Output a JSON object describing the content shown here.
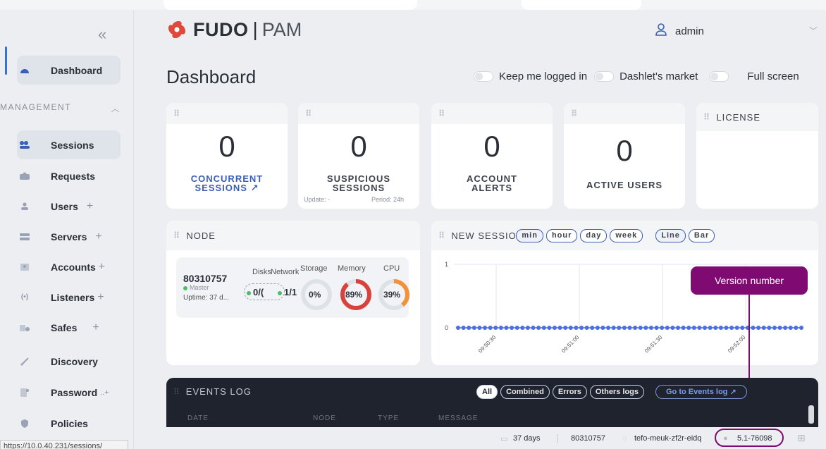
{
  "colors": {
    "accent": "#3a5fb8",
    "brand_red": "#e0483b",
    "annotation": "#7e0a72",
    "memory": "#d9423a",
    "cpu": "#f2913a",
    "series": "#4a6fdf"
  },
  "sidebar": {
    "collapse_icon": "double-chevron-left-icon",
    "section_label": "MANAGEMENT",
    "items": [
      {
        "label": "Dashboard",
        "icon": "dashboard-icon"
      },
      {
        "label": "Sessions",
        "icon": "sessions-icon"
      },
      {
        "label": "Requests",
        "icon": "requests-icon"
      },
      {
        "label": "Users",
        "icon": "users-icon",
        "plus": "+"
      },
      {
        "label": "Servers",
        "icon": "servers-icon",
        "plus": "+"
      },
      {
        "label": "Accounts",
        "icon": "accounts-icon",
        "plus": "+"
      },
      {
        "label": "Listeners",
        "icon": "listeners-icon",
        "plus": "+"
      },
      {
        "label": "Safes",
        "icon": "safes-icon",
        "plus": "+"
      },
      {
        "label": "Discovery",
        "icon": "discovery-icon"
      },
      {
        "label": "Password",
        "icon": "password-icon",
        "plus": "..+"
      },
      {
        "label": "Policies",
        "icon": "policies-icon"
      }
    ],
    "status_url": "https://10.0.40.231/sessions/"
  },
  "header": {
    "brand": "FUDO",
    "separator": "|",
    "product": "PAM",
    "user": "admin",
    "page_title": "Dashboard",
    "toggles": [
      "Keep me logged in",
      "Dashlet's market",
      "Full screen"
    ]
  },
  "stats": {
    "concurrent": {
      "value": "0",
      "label_line1": "CONCURRENT",
      "label_line2": "SESSIONS"
    },
    "suspicious": {
      "value": "0",
      "label_line1": "SUSPICIOUS",
      "label_line2": "SESSIONS",
      "update": "Update: -",
      "period": "Period: 24h"
    },
    "alerts": {
      "value": "0",
      "label_line1": "ACCOUNT",
      "label_line2": "ALERTS"
    },
    "active": {
      "value": "0",
      "label": "ACTIVE USERS"
    },
    "license": {
      "title": "LICENSE"
    }
  },
  "node": {
    "title": "NODE",
    "id": "80310757",
    "role": "Master",
    "uptime": "Uptime: 37 d...",
    "cols": {
      "disks": "Disks",
      "network": "Network",
      "storage": "Storage",
      "memory": "Memory",
      "cpu": "CPU"
    },
    "disks_value": "0/(",
    "network_value": "1/1",
    "storage_value": "0%",
    "memory_value": "89%",
    "cpu_value": "39%",
    "storage_pct": 0,
    "memory_pct": 89,
    "cpu_pct": 39
  },
  "sessions_chart": {
    "title": "NEW SESSIO",
    "ranges": [
      "min",
      "hour",
      "day",
      "week"
    ],
    "modes": [
      "Line",
      "Bar"
    ],
    "selected_range": "min",
    "selected_mode": "Line"
  },
  "chart_data": {
    "type": "line",
    "ylim": [
      0,
      1
    ],
    "y_ticks": [
      "0",
      "1"
    ],
    "x_ticks": [
      "09:50:30",
      "09:51:00",
      "09:51:30",
      "09:52:00"
    ],
    "series": [
      {
        "values": [
          0,
          0,
          0,
          0,
          0,
          0,
          0,
          0,
          0,
          0,
          0,
          0,
          0,
          0,
          0,
          0,
          0,
          0,
          0,
          0,
          0,
          0,
          0,
          0,
          0,
          0,
          0,
          0,
          0,
          0,
          0,
          0,
          0,
          0,
          0,
          0,
          0,
          0,
          0,
          0,
          0,
          0,
          0,
          0,
          0,
          0,
          0,
          0,
          0,
          0,
          0,
          0,
          0,
          0,
          0,
          0,
          0,
          0,
          0,
          0,
          0,
          0,
          0,
          0,
          0
        ]
      }
    ]
  },
  "events": {
    "title": "EVENTS LOG",
    "filters": [
      "All",
      "Combined",
      "Errors",
      "Others logs"
    ],
    "go_label": "Go to Events log",
    "columns": [
      "DATE",
      "NODE",
      "TYPE",
      "MESSAGE"
    ]
  },
  "footer": {
    "uptime": "37 days",
    "node": "80310757",
    "host": "tefo-meuk-zf2r-eidq",
    "version": "5.1-76098"
  },
  "annotation": {
    "label": "Version number"
  }
}
